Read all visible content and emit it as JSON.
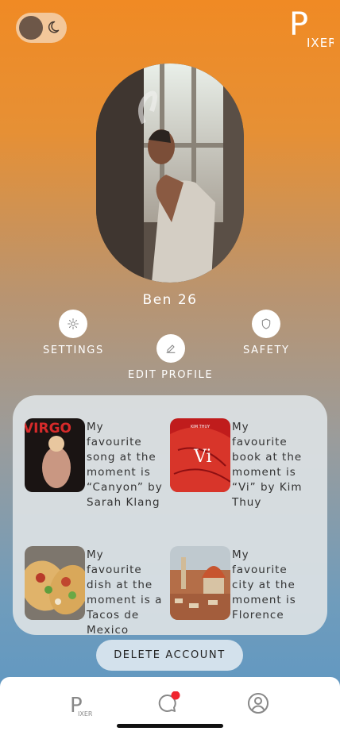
{
  "header": {
    "theme_toggle_icon": "moon-icon",
    "logo_letter": "P",
    "logo_text": "IXER"
  },
  "profile": {
    "name_age": "Ben 26",
    "photo_icon": "profile-photo"
  },
  "actions": {
    "settings_label": "SETTINGS",
    "settings_icon": "gear-icon",
    "edit_label": "EDIT PROFILE",
    "edit_icon": "pencil-icon",
    "safety_label": "SAFETY",
    "safety_icon": "shield-icon"
  },
  "favourites": [
    {
      "text": "My favourite song at the moment is “Canyon” by Sarah Klang",
      "image_text": "VIRGO",
      "image": "album-cover"
    },
    {
      "text": "My favourite book at the moment is “Vi” by Kim Thuy",
      "image_text": "Vi",
      "image_small_text": "KIM THUY",
      "image": "book-cover"
    },
    {
      "text": "My favourite dish at the moment is a Tacos de Mexico",
      "image": "tacos-photo"
    },
    {
      "text": "My favourite city at the moment is Florence",
      "image": "florence-photo"
    }
  ],
  "delete_button": "DELETE ACCOUNT",
  "nav": {
    "logo_letter": "P",
    "logo_text": "IXER",
    "chat_icon": "chat-icon",
    "profile_icon": "user-icon",
    "notification_color": "#f0252f"
  }
}
